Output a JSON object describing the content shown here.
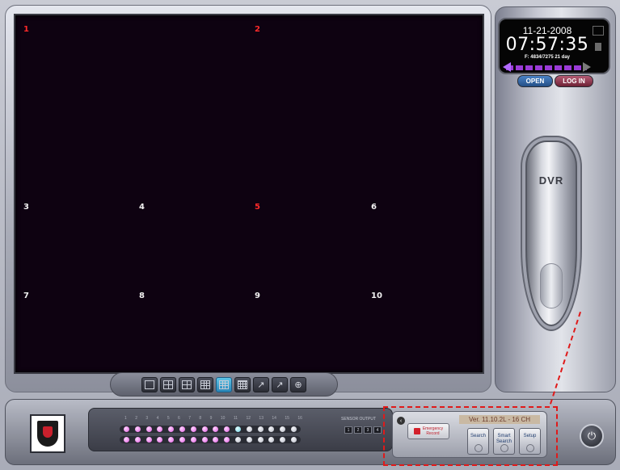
{
  "cameras": [
    {
      "label": "1",
      "color": "red"
    },
    {
      "label": "2",
      "color": "red"
    },
    {
      "label": "3",
      "color": "white"
    },
    {
      "label": "4",
      "color": "white"
    },
    {
      "label": "5",
      "color": "red"
    },
    {
      "label": "6",
      "color": "white"
    },
    {
      "label": "7",
      "color": "white"
    },
    {
      "label": "8",
      "color": "white"
    },
    {
      "label": "9",
      "color": "white"
    },
    {
      "label": "10",
      "color": "white"
    }
  ],
  "toolbar": {
    "buttons": [
      "single-view-icon",
      "quad-view-icon",
      "six-view-icon",
      "nine-view-icon",
      "ten-view-icon",
      "sixteen-view-icon",
      "rotate-icon",
      "sequence-icon",
      "zoom-icon"
    ],
    "active_index": 4,
    "rotate_glyph": "↗",
    "sequence_glyph": "↗",
    "zoom_glyph": "⊕"
  },
  "status": {
    "date": "11-21-2008",
    "time": "07:57:35",
    "free_space": "F: 4834/7275  21 day",
    "open_label": "OPEN",
    "login_label": "LOG IN"
  },
  "dvr_label": "DVR",
  "channel_numbers": [
    "1",
    "2",
    "3",
    "4",
    "5",
    "6",
    "7",
    "8",
    "9",
    "10",
    "11",
    "12",
    "13",
    "14",
    "15",
    "16"
  ],
  "led_row_1": [
    "on",
    "on",
    "on",
    "on",
    "on",
    "on",
    "on",
    "on",
    "on",
    "on",
    "cyan",
    "off",
    "off",
    "off",
    "off",
    "off"
  ],
  "led_row_2": [
    "on",
    "on",
    "on",
    "on",
    "on",
    "on",
    "on",
    "on",
    "on",
    "on",
    "off",
    "off",
    "off",
    "off",
    "off",
    "off"
  ],
  "sensor": {
    "label": "SENSOR OUTPUT",
    "buttons": [
      "1",
      "2",
      "3",
      "4"
    ]
  },
  "controls": {
    "version": "Ver. 11.10.2L - 16 CH",
    "collapse_glyph": "‹",
    "emergency_line1": "Emergency",
    "emergency_line2": "Record",
    "search": "Search",
    "smart_search_line1": "Smart",
    "smart_search_line2": "Search",
    "setup": "Setup"
  },
  "power_glyph": "⏻",
  "colors": {
    "annotation": "#e01a1a",
    "video_bg": "#0e0211",
    "led_on": "#e35ce3",
    "led_cyan": "#6ed2e6"
  }
}
